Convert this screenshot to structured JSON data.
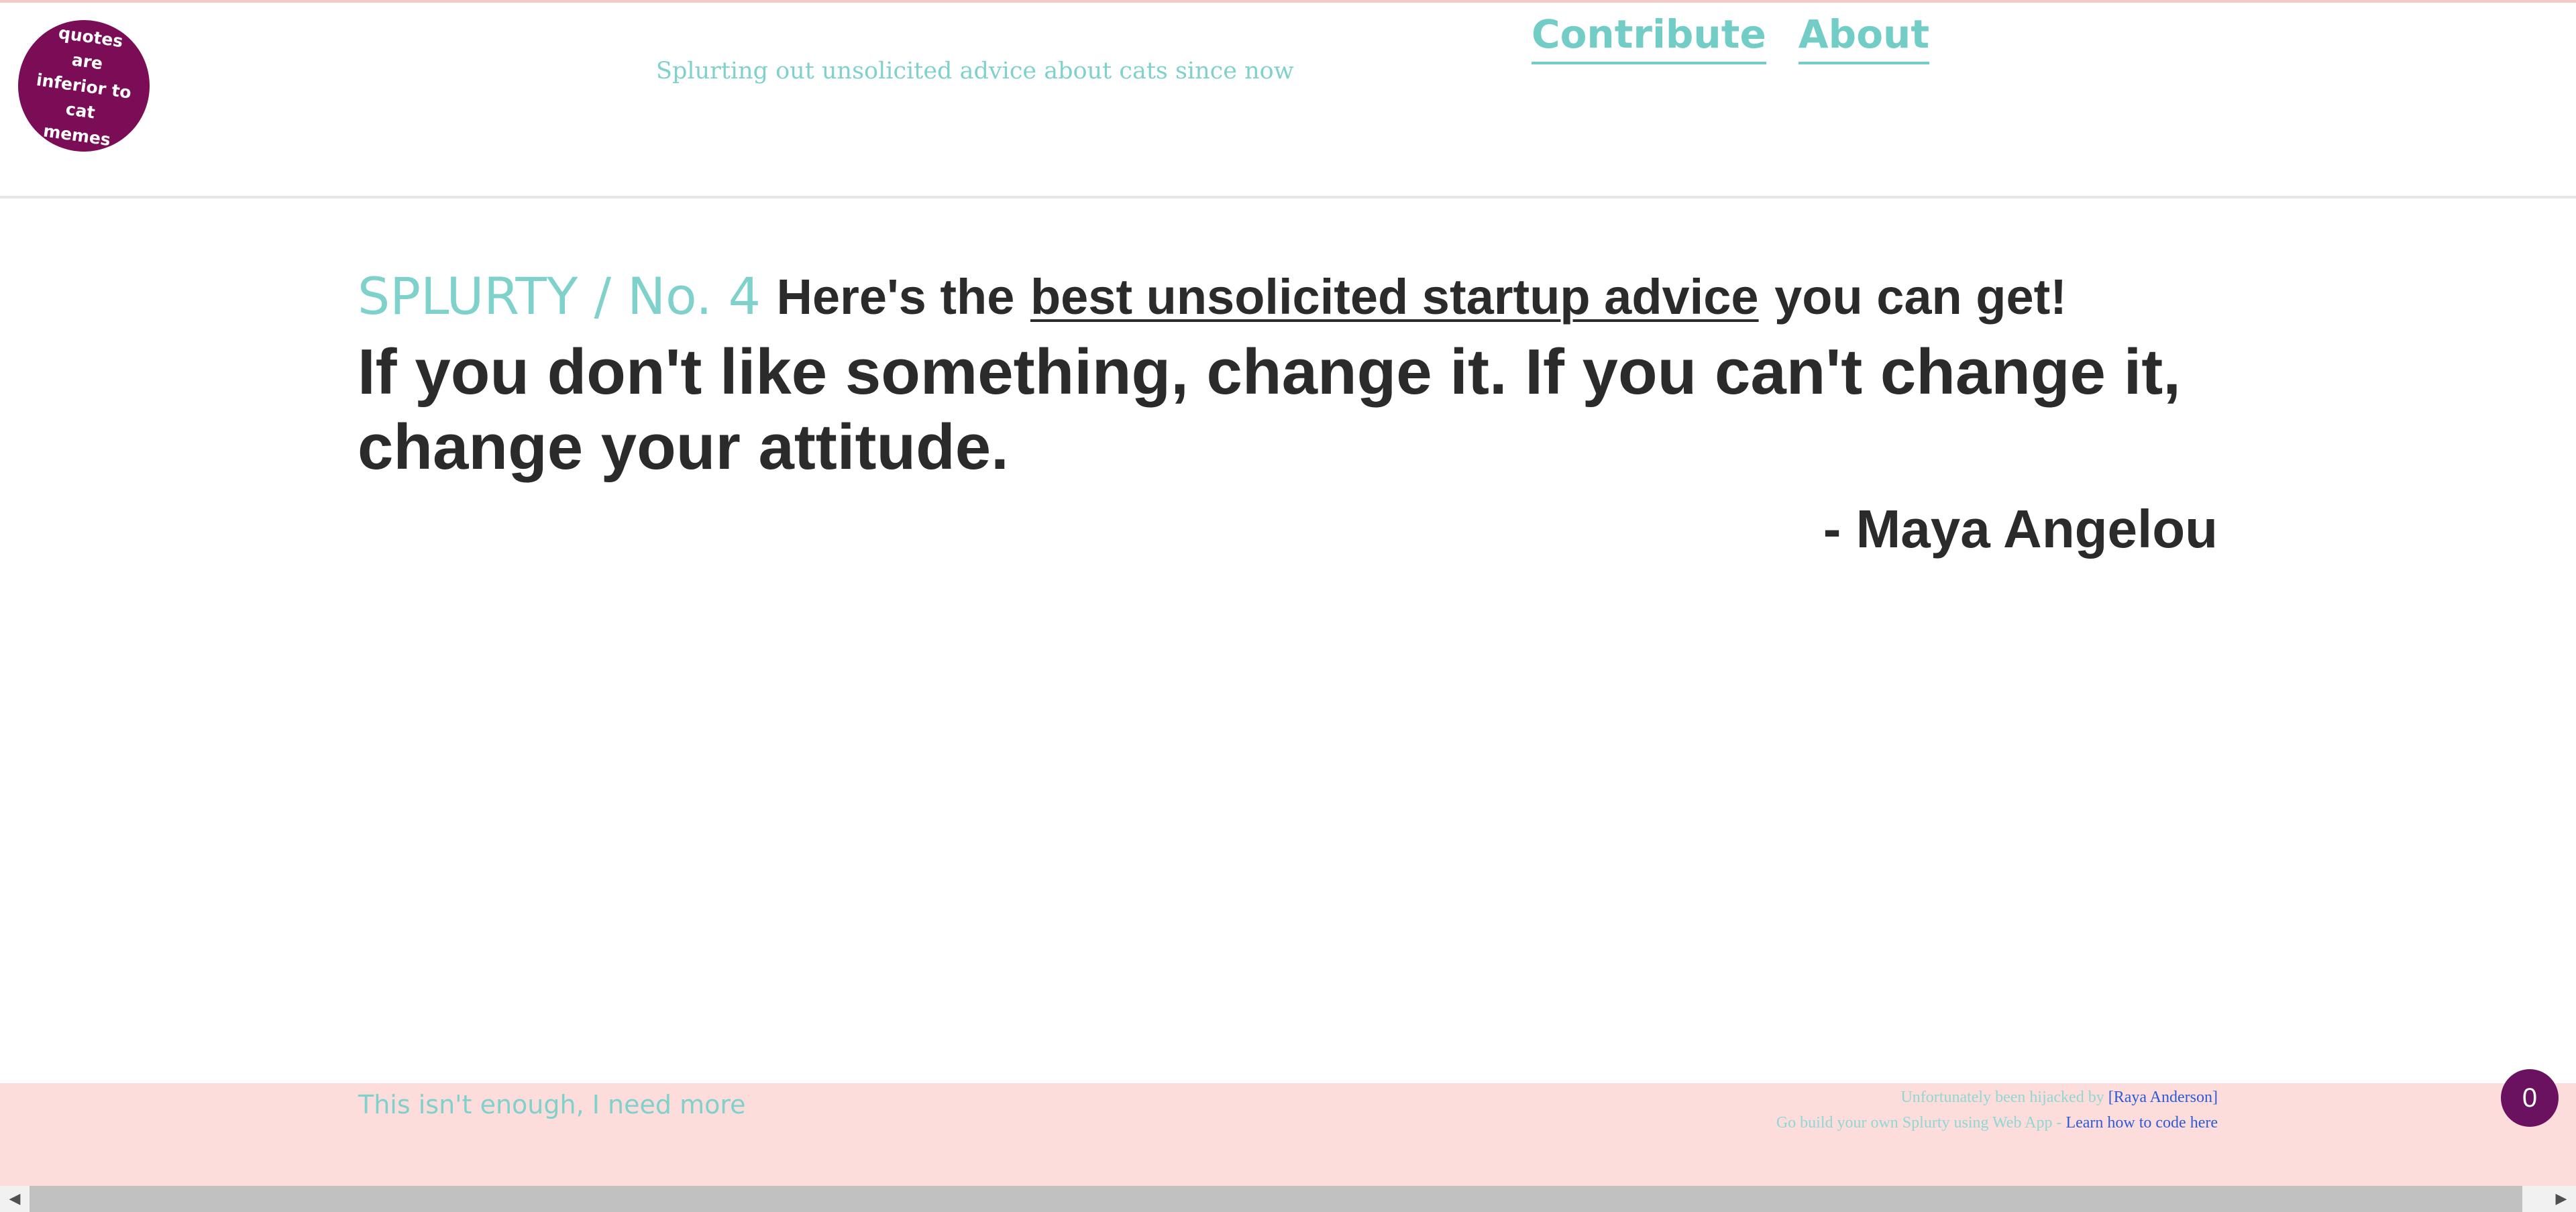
{
  "header": {
    "logo_text": "quotes are\ninferior to\ncat memes",
    "tagline": "Splurting out unsolicited advice about cats since now",
    "nav": {
      "contribute": "Contribute",
      "about": "About"
    }
  },
  "main": {
    "series_label": "SPLURTY / No. 4",
    "headline_lead": "Here's the",
    "headline_link": "best unsolicited startup advice",
    "headline_tail": "you can get!",
    "quote": "If you don't like something, change it. If you can't change it, change your attitude.",
    "author": "- Maya Angelou"
  },
  "footer": {
    "more_link": "This isn't enough, I need more",
    "hijack_text": "Unfortunately been hijacked by",
    "hijack_name": "[Raya Anderson]",
    "build_text": "Go build your own Splurty using Web App -",
    "build_link": "Learn how to code here"
  },
  "counter": {
    "value": "0"
  },
  "scrollbar": {
    "left_arrow": "◀",
    "right_arrow": "▶"
  },
  "colors": {
    "accent_teal": "#7fd1cb",
    "logo_purple": "#7b0c56",
    "footer_pink": "#fddcdc",
    "counter_purple": "#6a1160",
    "text_dark": "#2b2b2b",
    "link_blue": "#2a5bd7"
  }
}
